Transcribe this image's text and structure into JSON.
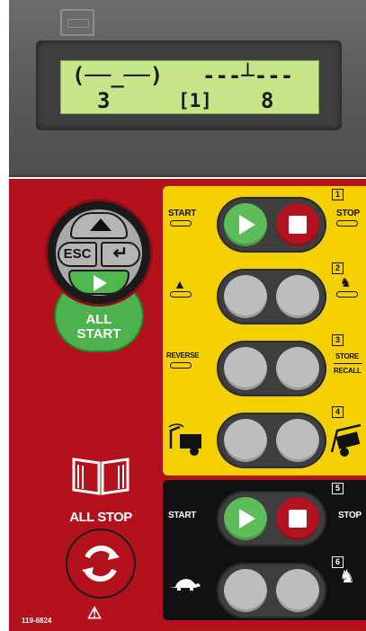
{
  "display": {
    "line1_left": "(──_──)",
    "line1_right": "---┴---",
    "value_left": "3",
    "value_mid": "[1]",
    "value_right": "8"
  },
  "nav": {
    "esc_label": "ESC",
    "enter_symbol": "↵",
    "all_start_label": "ALL START"
  },
  "groups": [
    {
      "number": "1",
      "left_label": "START",
      "right_label": "STOP"
    },
    {
      "number": "2"
    },
    {
      "number": "3",
      "left_label": "REVERSE",
      "right_label": "STORE",
      "right_sub_label": "RECALL"
    },
    {
      "number": "4"
    },
    {
      "number": "5",
      "left_label": "START",
      "right_label": "STOP"
    },
    {
      "number": "6"
    }
  ],
  "bottom": {
    "all_stop_label": "ALL STOP",
    "warning_symbol": "⚠",
    "part_code": "119-6824"
  },
  "colors": {
    "panel_red": "#b3121d",
    "yellow": "#f5d000",
    "green": "#5cbd5a",
    "lcd": "#c5e588"
  }
}
